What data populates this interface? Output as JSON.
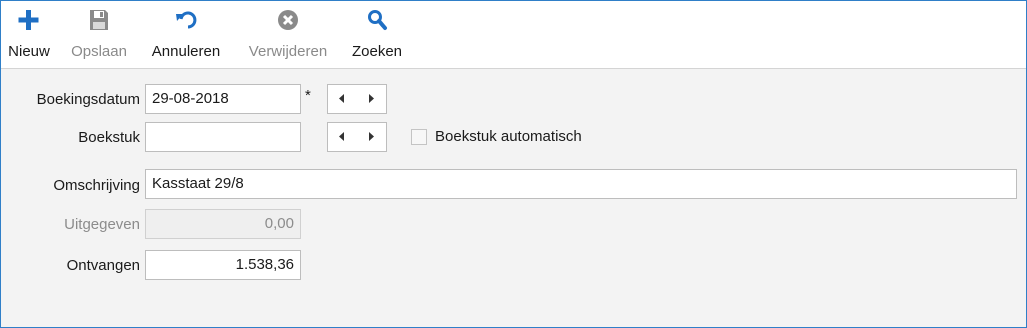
{
  "toolbar": {
    "buttons": [
      {
        "label": "Nieuw",
        "icon": "plus-icon",
        "enabled": true
      },
      {
        "label": "Opslaan",
        "icon": "floppy-disk-icon",
        "enabled": false
      },
      {
        "label": "Annuleren",
        "icon": "undo-icon",
        "enabled": true
      },
      {
        "label": "Verwijderen",
        "icon": "delete-circle-icon",
        "enabled": false
      },
      {
        "label": "Zoeken",
        "icon": "search-icon",
        "enabled": true
      }
    ]
  },
  "form": {
    "boekingsdatum": {
      "label": "Boekingsdatum",
      "value": "29-08-2018",
      "required_marker": "*"
    },
    "boekstuk": {
      "label": "Boekstuk",
      "value": "",
      "auto_label": "Boekstuk automatisch",
      "auto_checked": false
    },
    "omschrijving": {
      "label": "Omschrijving",
      "value": "Kasstaat 29/8"
    },
    "uitgegeven": {
      "label": "Uitgegeven",
      "value": "0,00",
      "enabled": false
    },
    "ontvangen": {
      "label": "Ontvangen",
      "value": "1.538,36"
    }
  },
  "colors": {
    "accent": "#1f6fc4",
    "disabled": "#8a8a8a",
    "frame": "#2f7fc8"
  }
}
